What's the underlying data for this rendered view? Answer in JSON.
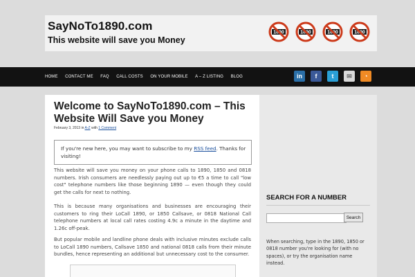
{
  "header": {
    "site_title": "SayNoTo1890.com",
    "tagline": "This website will save you Money",
    "logo_text": [
      "1890",
      "1890",
      "1890",
      "1890"
    ],
    "logo_colors": {
      "circle": "#cc3a1a",
      "badge": "#1a1a1a"
    }
  },
  "nav": {
    "items": [
      "HOME",
      "CONTACT ME",
      "FAQ",
      "CALL COSTS",
      "ON YOUR MOBILE",
      "A – Z LISTING",
      "BLOG"
    ],
    "social_icons": [
      "linkedin-icon",
      "facebook-icon",
      "twitter-icon",
      "email-icon",
      "rss-icon"
    ],
    "social_glyphs": [
      "in",
      "f",
      "t",
      "✉",
      "◔"
    ],
    "social_colors": [
      "#2a6fa8",
      "#3b5998",
      "#2a9fd6",
      "#d9d9d9",
      "#f08a24"
    ]
  },
  "post": {
    "title": "Welcome to SayNoTo1890.com – This Website Will Save you Money",
    "date": "February 3, 2013",
    "in_text": "in",
    "category": "A-Z",
    "with_text": "with",
    "comments": "1 Comment",
    "notice_pre": "If you're new here, you may want to subscribe to my",
    "notice_link": "RSS feed",
    "notice_post": ". Thanks for visiting!",
    "paragraphs": [
      "This website will save you money on your phone calls to 1890, 1850 and 0818 numbers. Irish consumers are needlessly paying out up to €5 a time to call \"low cost\" telephone numbers like those beginning 1890 — even though they could get the calls for next to nothing.",
      "This is because many organisations and businesses are encouraging their customers to ring their LoCall 1890, or 1850 Callsave, or 0818 National Call telephone numbers at local call rates costing 4.9c a minute in the daytime and 1.26c off-peak.",
      "But popular mobile and landline phone deals with inclusive minutes exclude calls to LoCall 1890 numbers, Callsave 1850 and national 0818 calls from their minute bundles, hence representing an additional but unnecessary cost to the consumer."
    ]
  },
  "sidebar": {
    "widget_title": "SEARCH FOR A NUMBER",
    "search_value": "",
    "search_button": "Search",
    "help_text": "When searching, type in the 1890, 1850 or 0818 number you're looking for (with no spaces), or try the organisation name instead."
  }
}
